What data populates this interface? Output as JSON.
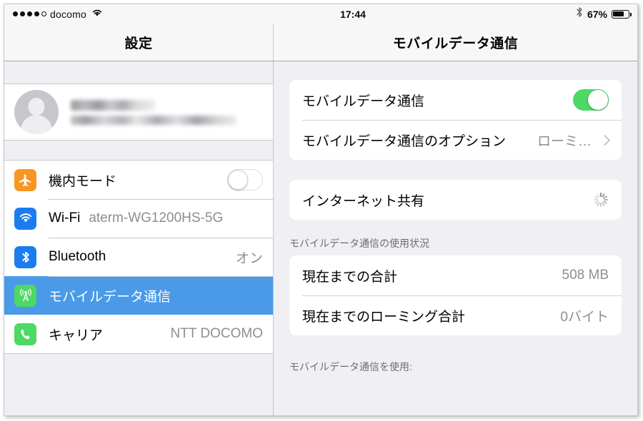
{
  "status_bar": {
    "signal_dots_filled": 4,
    "signal_dots_total": 5,
    "carrier": "docomo",
    "wifi_icon": "wifi-icon",
    "time": "17:44",
    "bluetooth_icon": "bluetooth-icon",
    "battery_percent_label": "67%",
    "battery_level": 67
  },
  "sidebar": {
    "title": "設定",
    "profile": {
      "name_redacted": true,
      "subtitle_redacted": true
    },
    "items": [
      {
        "label": "機内モード",
        "icon": "airplane-icon",
        "icon_color": "#f79622",
        "control": "toggle",
        "toggle_on": false,
        "value": ""
      },
      {
        "label": "Wi-Fi",
        "icon": "wifi-icon",
        "icon_color": "#1c7cee",
        "control": "value",
        "value": "aterm-WG1200HS-5G"
      },
      {
        "label": "Bluetooth",
        "icon": "bluetooth-icon",
        "icon_color": "#1c7cee",
        "control": "value",
        "value": "オン"
      },
      {
        "label": "モバイルデータ通信",
        "icon": "cellular-tower-icon",
        "icon_color": "#4cd964",
        "control": "none",
        "value": "",
        "selected": true
      },
      {
        "label": "キャリア",
        "icon": "phone-icon",
        "icon_color": "#4cd964",
        "control": "value",
        "value": "NTT DOCOMO"
      }
    ]
  },
  "detail": {
    "title": "モバイルデータ通信",
    "group1": [
      {
        "label": "モバイルデータ通信",
        "control": "toggle",
        "toggle_on": true
      },
      {
        "label": "モバイルデータ通信のオプション",
        "control": "disclosure",
        "value": "ローミ…"
      }
    ],
    "group2": [
      {
        "label": "インターネット共有",
        "control": "spinner",
        "value": ""
      }
    ],
    "usage_section_header": "モバイルデータ通信の使用状況",
    "usage": [
      {
        "label": "現在までの合計",
        "value": "508 MB"
      },
      {
        "label": "現在までのローミング合計",
        "value": "0バイト"
      }
    ],
    "footer_section_header": "モバイルデータ通信を使用:"
  },
  "colors": {
    "selection_blue": "#4a9ae8",
    "toggle_green": "#4cd964",
    "icon_orange": "#f79622",
    "icon_blue": "#1c7cee",
    "pane_background": "#efeff4",
    "secondary_text": "#8e8e93"
  }
}
